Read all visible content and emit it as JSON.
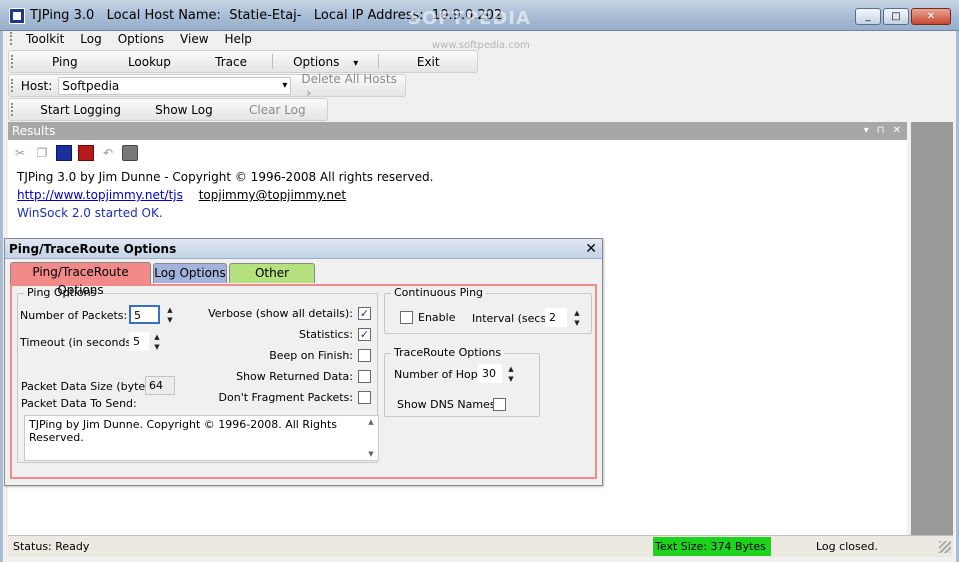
{
  "window": {
    "title": "TJPing 3.0   Local Host Name:  Statie-Etaj-   Local IP Address:  10.9.0.202",
    "watermark": "SOFTPEDIA",
    "watermark_url": "www.softpedia.com",
    "min_label": "_",
    "max_label": "□",
    "close_label": "✕"
  },
  "menu": [
    "Toolkit",
    "Log",
    "Options",
    "View",
    "Help"
  ],
  "toolbar": {
    "ping": "Ping",
    "lookup": "Lookup",
    "trace": "Trace",
    "options": "Options",
    "options_arrow": "▾",
    "exit": "Exit"
  },
  "hostbar": {
    "label": "Host:",
    "value": "Softpedia",
    "dropdown_arrow": "▾",
    "delete_all": "Delete All Hosts",
    "delete_arrow": "›"
  },
  "logbar": {
    "start": "Start Logging",
    "show": "Show Log",
    "clear": "Clear Log"
  },
  "results": {
    "header": "Results",
    "pane_controls": [
      "▾",
      "⊓",
      "✕"
    ],
    "line1": "TJPing 3.0 by Jim Dunne - Copyright © 1996-2008  All rights reserved.",
    "link": "http://www.topjimmy.net/tjs",
    "email": "topjimmy@topjimmy.net",
    "line3": "WinSock 2.0  started OK."
  },
  "dialog": {
    "title": "Ping/TraceRoute Options",
    "close": "✕",
    "tabs": [
      "Ping/TraceRoute Options",
      "Log Options",
      "Other Options"
    ],
    "ping_options": {
      "title": "Ping Options",
      "num_packets_label": "Number of Packets:",
      "num_packets_value": "5",
      "timeout_label": "Timeout (in seconds):",
      "timeout_value": "5",
      "packet_size_label": "Packet Data Size (bytes):",
      "packet_size_value": "64",
      "packet_send_label": "Packet Data To Send:",
      "packet_send_text": "TJPing by Jim Dunne. Copyright © 1996-2008. All Rights Reserved.",
      "verbose_label": "Verbose (show all details):",
      "verbose_checked": true,
      "statistics_label": "Statistics:",
      "statistics_checked": true,
      "beep_label": "Beep on Finish:",
      "beep_checked": false,
      "show_returned_label": "Show Returned Data:",
      "show_returned_checked": false,
      "dont_fragment_label": "Don't Fragment Packets:",
      "dont_fragment_checked": false
    },
    "continuous_ping": {
      "title": "Continuous Ping",
      "enable_label": "Enable",
      "enable_checked": false,
      "interval_label": "Interval (secs):",
      "interval_value": "2"
    },
    "traceroute_options": {
      "title": "TraceRoute Options",
      "hops_label": "Number of Hops:",
      "hops_value": "30",
      "show_dns_label": "Show DNS Names:",
      "show_dns_checked": false
    },
    "spin_up": "▲",
    "spin_down": "▼",
    "check_mark": "✓"
  },
  "status": {
    "ready": "Status: Ready",
    "text_size": "Text Size: 374 Bytes",
    "log": "Log closed."
  },
  "colors": {
    "tab_ping": "#f28a8a",
    "tab_log": "#a3b3dc",
    "tab_other": "#b4e07e",
    "status_green": "#1ed31e"
  }
}
